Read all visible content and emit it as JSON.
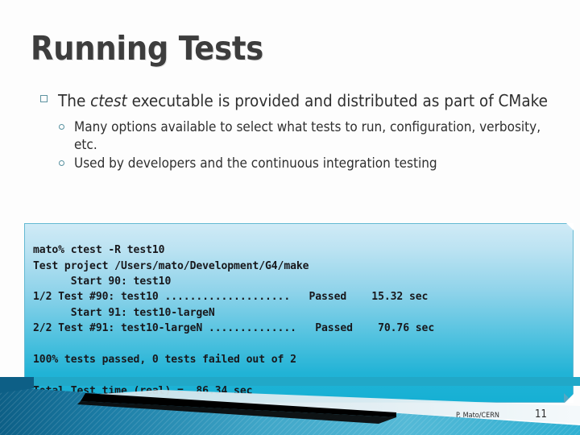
{
  "slide": {
    "title": "Running Tests",
    "bullets": [
      {
        "level": 1,
        "marker": "hollow-square",
        "segments": [
          {
            "text": "The ",
            "style": "normal"
          },
          {
            "text": "ctest",
            "style": "italic"
          },
          {
            "text": " executable is provided and distributed as part of CMake",
            "style": "normal"
          }
        ],
        "text": "The ctest executable is provided and distributed as part of CMake"
      },
      {
        "level": 2,
        "marker": "hollow-circle",
        "text": "Many options available to select what tests to run, configuration, verbosity, etc."
      },
      {
        "level": 2,
        "marker": "hollow-circle",
        "text": "Used by developers and the continuous integration testing"
      }
    ],
    "terminal": {
      "lines": [
        "mato% ctest -R test10",
        "Test project /Users/mato/Development/G4/make",
        "      Start 90: test10",
        "1/2 Test #90: test10 ....................   Passed    15.32 sec",
        "      Start 91: test10-largeN",
        "2/2 Test #91: test10-largeN ..............   Passed    70.76 sec",
        "",
        "100% tests passed, 0 tests failed out of 2",
        "",
        "Total Test time (real) =  86.34 sec"
      ],
      "text": "mato% ctest -R test10\nTest project /Users/mato/Development/G4/make\n      Start 90: test10\n1/2 Test #90: test10 ....................   Passed    15.32 sec\n      Start 91: test10-largeN\n2/2 Test #91: test10-largeN ..............   Passed    70.76 sec\n\n100% tests passed, 0 tests failed out of 2\n\nTotal Test time (real) =  86.34 sec",
      "command": "ctest -R test10",
      "prompt": "mato%",
      "project_path": "/Users/mato/Development/G4/make",
      "tests": [
        {
          "index": "1/2",
          "number": "#90",
          "name": "test10",
          "status": "Passed",
          "time": "15.32",
          "unit": "sec"
        },
        {
          "index": "2/2",
          "number": "#91",
          "name": "test10-largeN",
          "status": "Passed",
          "time": "70.76",
          "unit": "sec"
        }
      ],
      "summary": "100% tests passed, 0 tests failed out of 2",
      "total_time": "Total Test time (real) =  86.34 sec"
    },
    "footer": {
      "author": "P. Mato/CERN",
      "page_number": "11"
    },
    "colors": {
      "title": "#3d3d3d",
      "bullet_marker": "#5d93a0",
      "terminal_top": "#cfeaf6",
      "terminal_bottom": "#16b0d4",
      "accent_cyan": "#21a8c8",
      "deco_dark_blue": "#12688f"
    }
  }
}
